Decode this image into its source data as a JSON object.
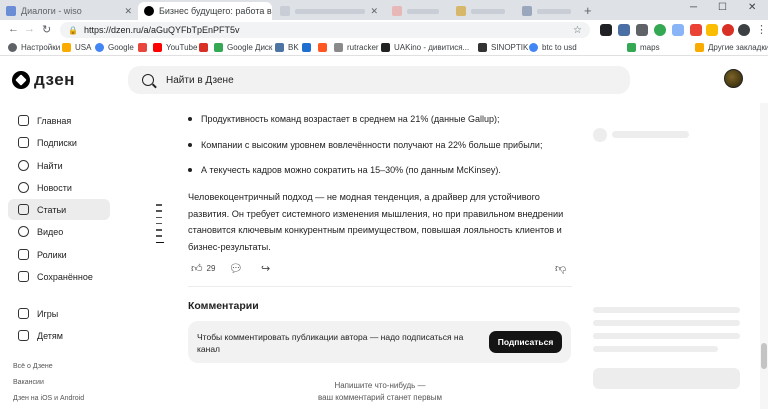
{
  "browser": {
    "tabs": [
      {
        "title": "Диалоги - wiso",
        "active": false
      },
      {
        "title": "Бизнес будущего: работа в кайо",
        "active": true
      },
      {
        "title": "",
        "active": false
      },
      {
        "title": "",
        "active": false
      },
      {
        "title": "",
        "active": false
      },
      {
        "title": "",
        "active": false
      }
    ],
    "new_tab": "+",
    "url": "https://dzen.ru/a/aGuQYFbTpEnPFT5v",
    "bookmarks": [
      {
        "label": "Настройки",
        "color": "#5f6368"
      },
      {
        "label": "USA",
        "color": "#f9ab00"
      },
      {
        "label": "Google",
        "color": "#4285f4"
      },
      {
        "label": "",
        "color": "#e8453c"
      },
      {
        "label": "YouTube",
        "color": "#ff0000"
      },
      {
        "label": "",
        "color": "#d93025"
      },
      {
        "label": "Google Диск",
        "color": "#34a853"
      },
      {
        "label": "BK",
        "color": "#4c75a3"
      },
      {
        "label": "",
        "color": "#1f6fd1"
      },
      {
        "label": "",
        "color": "#ff5722"
      },
      {
        "label": "rutracker",
        "color": "#8a8a8a"
      },
      {
        "label": "UAKino - дивитися...",
        "color": "#222222"
      },
      {
        "label": "SINOPTIK",
        "color": "#333333"
      },
      {
        "label": "btc to usd",
        "color": "#4285f4"
      },
      {
        "label": "maps",
        "color": "#34a853"
      }
    ],
    "other_bookmarks": "Другие закладки"
  },
  "header": {
    "logo_text": "дзен",
    "search_placeholder": "Найти в Дзене"
  },
  "sidebar": {
    "items": [
      {
        "label": "Главная",
        "icon": "home-icon",
        "selected": false
      },
      {
        "label": "Подписки",
        "icon": "subscriptions-icon",
        "selected": false
      },
      {
        "label": "Найти",
        "icon": "search-icon",
        "selected": false
      },
      {
        "label": "Новости",
        "icon": "news-icon",
        "selected": false
      },
      {
        "label": "Статьи",
        "icon": "articles-icon",
        "selected": true
      },
      {
        "label": "Видео",
        "icon": "video-icon",
        "selected": false
      },
      {
        "label": "Ролики",
        "icon": "shorts-icon",
        "selected": false
      },
      {
        "label": "Сохранённое",
        "icon": "bookmark-icon",
        "selected": false
      },
      {
        "label": "Игры",
        "icon": "gamepad-icon",
        "selected": false
      },
      {
        "label": "Детям",
        "icon": "kids-icon",
        "selected": false
      }
    ],
    "footer": [
      "Всё о Дзене",
      "Вакансии",
      "Дзен на iOS и Android"
    ]
  },
  "article": {
    "bullets": [
      "Продуктивность команд возрастает в среднем на 21% (данные Gallup);",
      "Компании с высоким уровнем вовлечённости получают на 22% больше прибыли;",
      "А текучесть кадров можно сократить на 15–30% (по данным McKinsey)."
    ],
    "paragraph": "Человекоцентричный подход — не модная тенденция, а драйвер для устойчивого развития. Он требует системного изменения мышления, но при правильном внедрении становится ключевым конкурентным преимуществом, повышая лояльность клиентов и бизнес-результаты.",
    "likes": "29"
  },
  "comments": {
    "title": "Комментарии",
    "notice": "Чтобы комментировать публикации автора — надо подписаться на канал",
    "subscribe_label": "Подписаться",
    "empty_line1": "Напишите что-нибудь —",
    "empty_line2": "ваш комментарий станет первым"
  }
}
